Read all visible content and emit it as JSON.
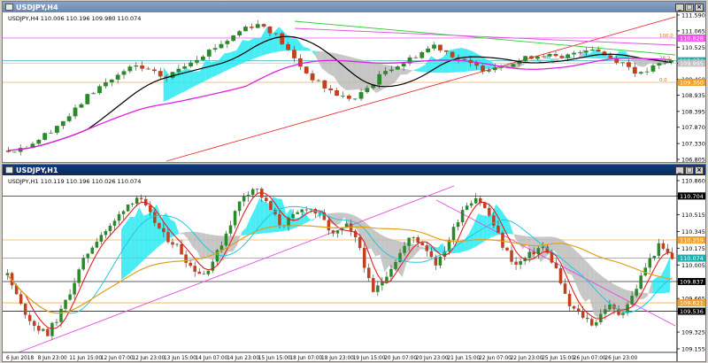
{
  "windows": [
    {
      "title": "USDJPY,H4",
      "active": false,
      "info": "USDJPY,H4  110.006 110.196 109.980 110.074",
      "price_labels": [
        "111.590",
        "111.065",
        "110.525",
        "109.995",
        "109.460",
        "108.935",
        "108.395",
        "107.870",
        "107.330",
        "106.805"
      ],
      "tags": [
        {
          "text": "110.828",
          "price": 110.828,
          "color": "#ee55ee"
        },
        {
          "text": "110.074",
          "price": 110.074,
          "color": "#22aaaa"
        },
        {
          "text": "109.995",
          "price": 109.995,
          "color": "#c0c0c0"
        },
        {
          "text": "109.360",
          "price": 109.36,
          "color": "#f0a030"
        }
      ],
      "fib_labels": [
        {
          "text": "100.0",
          "price": 110.828
        },
        {
          "text": "38.2",
          "price": 110.074
        },
        {
          "text": "0.0",
          "price": 109.36
        }
      ]
    },
    {
      "title": "USDJPY,H1",
      "active": true,
      "info": "USDJPY,H1  110.119 110.196 110.026 110.074",
      "price_labels": [
        "110.860",
        "110.704",
        "110.515",
        "110.345",
        "110.175",
        "110.005",
        "109.837",
        "109.665",
        "109.536",
        "109.325",
        "109.155"
      ],
      "tags": [
        {
          "text": "110.704",
          "price": 110.704,
          "color": "#000000"
        },
        {
          "text": "110.259",
          "price": 110.259,
          "color": "#f0a030"
        },
        {
          "text": "110.074",
          "price": 110.074,
          "color": "#22aaaa"
        },
        {
          "text": "109.837",
          "price": 109.837,
          "color": "#000000"
        },
        {
          "text": "109.621",
          "price": 109.621,
          "color": "#f0a030"
        },
        {
          "text": "109.536",
          "price": 109.536,
          "color": "#000000"
        }
      ]
    }
  ],
  "time_labels": [
    "6 Jun 2018",
    "8 Jun 23:00",
    "11 Jun 15:00",
    "12 Jun 07:00",
    "12 Jun 23:00",
    "13 Jun 15:00",
    "14 Jun 07:00",
    "14 Jun 23:00",
    "15 Jun 15:00",
    "18 Jun 07:00",
    "18 Jun 23:00",
    "19 Jun 15:00",
    "20 Jun 07:00",
    "20 Jun 23:00",
    "21 Jun 15:00",
    "22 Jun 07:00",
    "22 Jun 23:00",
    "25 Jun 15:00",
    "26 Jun 07:00",
    "26 Jun 23:00"
  ],
  "chart_data": [
    {
      "type": "candlestick",
      "symbol": "USDJPY",
      "timeframe": "H4",
      "ylim": [
        106.805,
        111.59
      ],
      "last": {
        "open": 110.006,
        "high": 110.196,
        "low": 109.98,
        "close": 110.074
      },
      "horizontal_levels": [
        110.828,
        110.074,
        109.995,
        109.36
      ],
      "close_path": [
        107.1,
        107.2,
        107.5,
        107.9,
        108.3,
        108.9,
        109.3,
        109.6,
        109.9,
        109.7,
        109.5,
        109.9,
        110.2,
        110.5,
        110.8,
        111.2,
        111.3,
        110.9,
        110.2,
        109.6,
        109.2,
        108.9,
        108.8,
        109.3,
        109.8,
        110.0,
        110.3,
        110.6,
        110.3,
        110.0,
        109.8,
        109.9,
        110.0,
        110.2,
        110.3,
        110.1,
        110.4,
        110.5,
        110.2,
        110.0,
        109.6,
        109.9,
        110.07
      ]
    },
    {
      "type": "candlestick",
      "symbol": "USDJPY",
      "timeframe": "H1",
      "ylim": [
        109.155,
        110.86
      ],
      "last": {
        "open": 110.119,
        "high": 110.196,
        "low": 110.026,
        "close": 110.074
      },
      "horizontal_levels": [
        110.704,
        110.259,
        110.074,
        109.837,
        109.621,
        109.536
      ],
      "close_path": [
        109.9,
        109.6,
        109.4,
        109.3,
        109.5,
        109.8,
        110.1,
        110.3,
        110.4,
        110.6,
        110.7,
        110.5,
        110.3,
        110.2,
        110.0,
        109.9,
        110.1,
        110.4,
        110.7,
        110.8,
        110.6,
        110.4,
        110.5,
        110.6,
        110.5,
        110.3,
        110.4,
        110.2,
        109.7,
        109.9,
        110.1,
        110.3,
        110.2,
        110.0,
        110.3,
        110.6,
        110.7,
        110.5,
        110.2,
        110.0,
        110.1,
        110.2,
        110.0,
        109.6,
        109.5,
        109.4,
        109.6,
        109.5,
        109.7,
        110.0,
        110.2,
        110.07
      ]
    }
  ]
}
